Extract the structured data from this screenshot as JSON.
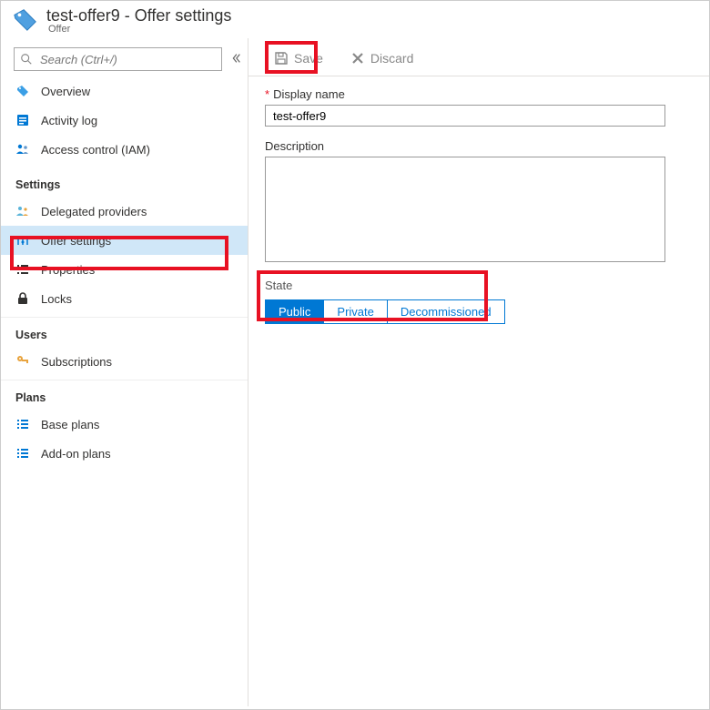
{
  "header": {
    "title": "test-offer9 - Offer settings",
    "subtitle": "Offer"
  },
  "search": {
    "placeholder": "Search (Ctrl+/)"
  },
  "sidebar": {
    "top": [
      {
        "label": "Overview"
      },
      {
        "label": "Activity log"
      },
      {
        "label": "Access control (IAM)"
      }
    ],
    "groups": {
      "settings": {
        "label": "Settings",
        "items": [
          {
            "label": "Delegated providers"
          },
          {
            "label": "Offer settings"
          },
          {
            "label": "Properties"
          },
          {
            "label": "Locks"
          }
        ]
      },
      "users": {
        "label": "Users",
        "items": [
          {
            "label": "Subscriptions"
          }
        ]
      },
      "plans": {
        "label": "Plans",
        "items": [
          {
            "label": "Base plans"
          },
          {
            "label": "Add-on plans"
          }
        ]
      }
    }
  },
  "toolbar": {
    "save_label": "Save",
    "discard_label": "Discard"
  },
  "form": {
    "display_name_label": "Display name",
    "display_name_value": "test-offer9",
    "description_label": "Description",
    "description_value": "",
    "state_label": "State",
    "state_options": {
      "public": "Public",
      "private": "Private",
      "decommissioned": "Decommissioned"
    },
    "state_selected": "Public"
  }
}
